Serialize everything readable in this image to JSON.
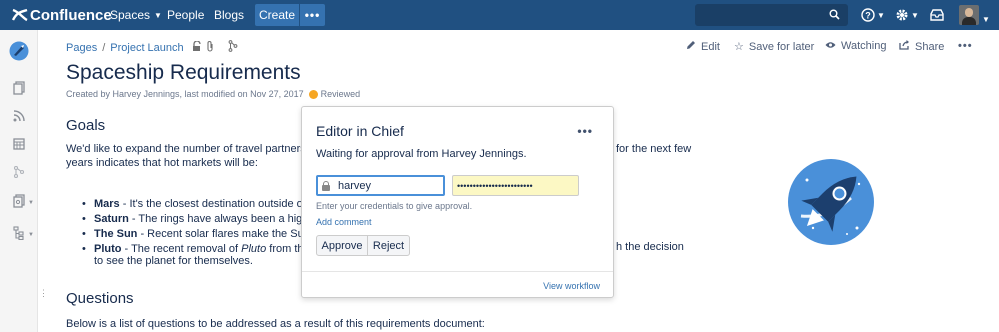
{
  "topnav": {
    "logo_text": "Confluence",
    "spaces": "Spaces",
    "people": "People",
    "blogs": "Blogs",
    "create": "Create",
    "more": "•••",
    "colors": {
      "bar": "#205081",
      "create": "#3572b0"
    }
  },
  "breadcrumb": {
    "pages": "Pages",
    "sep": "/",
    "project": "Project Launch"
  },
  "actions": {
    "edit": "Edit",
    "save": "Save for later",
    "watching": "Watching",
    "share": "Share",
    "more": "•••"
  },
  "page": {
    "title": "Spaceship Requirements",
    "meta": "Created by Harvey Jennings, last modified on Nov 27, 2017",
    "status": "Reviewed"
  },
  "content": {
    "goals_heading": "Goals",
    "goals_line1_a": "We'd like to expand the number of travel partners to gr",
    "goals_line1_b": "for the next few",
    "goals_line2": "years indicates that hot markets will be:",
    "bullets": [
      {
        "name": "Mars",
        "text": " - It's the closest destination outside of the r"
      },
      {
        "name": "Saturn",
        "text": " - The rings have always been a high drav"
      },
      {
        "name": "The Sun",
        "text": " - Recent solar flares make the Sun a k"
      },
      {
        "name": "Pluto",
        "text": " - The recent removal of ",
        "italic": "Pluto",
        "text2": " from the list"
      }
    ],
    "pluto_tail": "h the decision",
    "pluto_line2": "to see the planet for themselves.",
    "questions_heading": "Questions",
    "questions_text": "Below is a list of questions to be addressed as a result of this requirements document:"
  },
  "popup": {
    "title": "Editor in Chief",
    "dots": "•••",
    "message": "Waiting for approval from Harvey Jennings.",
    "username_value": "harvey",
    "password_value": "••••••••••••••••••••••••",
    "hint": "Enter your credentials to give approval.",
    "add_comment": "Add comment",
    "approve": "Approve",
    "reject": "Reject",
    "view_workflow": "View workflow"
  },
  "icons": {
    "search": "search-icon",
    "help": "help-icon",
    "settings": "gear-icon",
    "notifications": "notification-icon",
    "lock": "lock-icon"
  }
}
